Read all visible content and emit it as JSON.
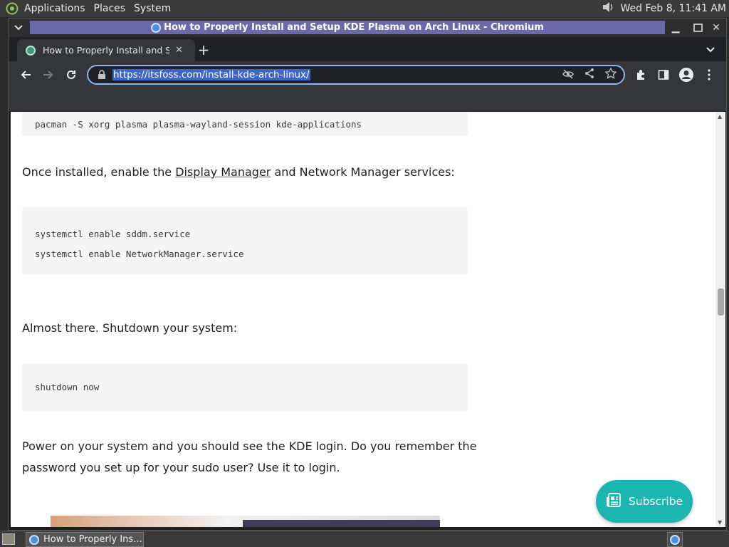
{
  "top_panel": {
    "menus": [
      "Applications",
      "Places",
      "System"
    ],
    "clock": "Wed Feb  8, 11:41 AM",
    "icons": [
      "distro-icon",
      "volume-icon"
    ]
  },
  "window": {
    "title": "How to Properly Install and Setup KDE Plasma on Arch Linux - Chromium"
  },
  "browser": {
    "tab_title": "How to Properly Install and Setup KDE Plasma on Arch Linux",
    "url": "https://itsfoss.com/install-kde-arch-linux/"
  },
  "page": {
    "code1": "pacman -S xorg plasma plasma-wayland-session kde-applications",
    "para1_before": "Once installed, enable the ",
    "para1_link": "Display Manager",
    "para1_after": " and Network Manager services:",
    "code2_line1": "systemctl enable sddm.service",
    "code2_line2": "systemctl enable NetworkManager.service",
    "para2": "Almost there. Shutdown your system:",
    "code3": "shutdown now",
    "para3_line1": "Power on your system and you should see the KDE login. Do you remember the",
    "para3_line2": "password you set up for your sudo user? Use it to login.",
    "subscribe": "Subscribe"
  },
  "taskbar": {
    "task_label": "How to Properly Ins..."
  },
  "colors": {
    "accent": "#8ab4f8",
    "subscribe": "#1bb6b0",
    "url_highlight": "#3d66c7"
  }
}
